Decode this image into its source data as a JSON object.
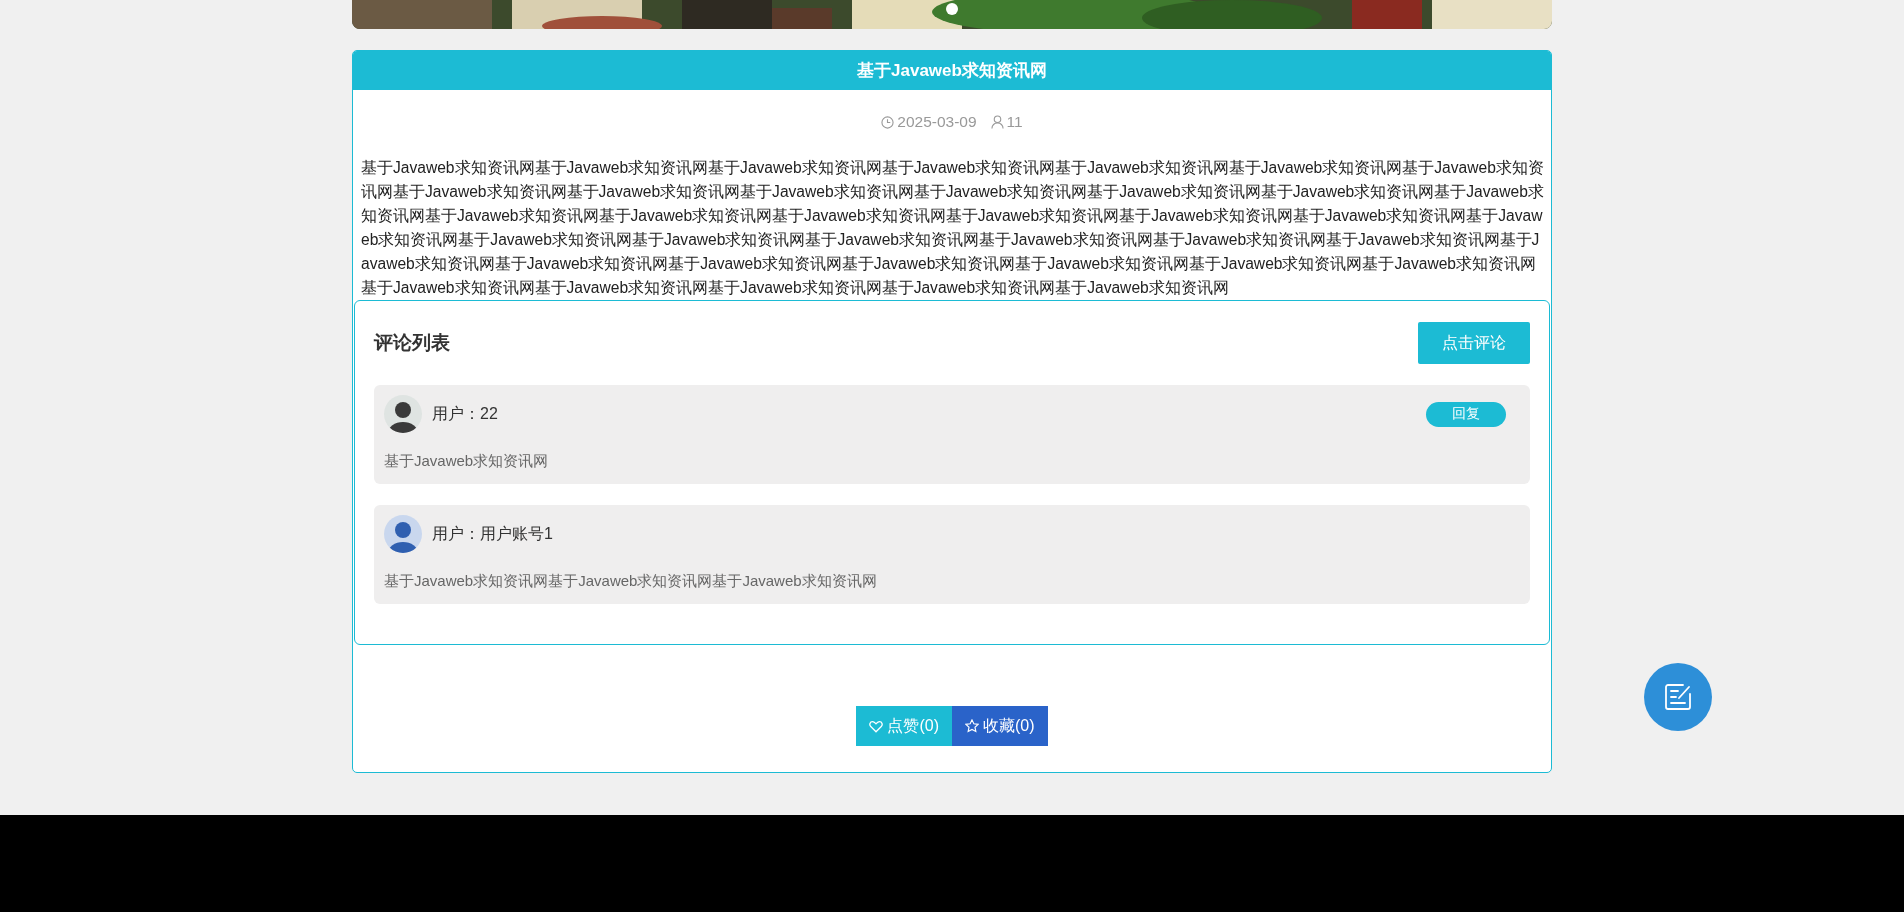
{
  "banner": {
    "kind": "picture",
    "dots": [
      {
        "selected": true
      }
    ]
  },
  "article": {
    "title": "基于Javaweb求知资讯网",
    "date": "2025-03-09",
    "views": "11",
    "body": "基于Javaweb求知资讯网基于Javaweb求知资讯网基于Javaweb求知资讯网基于Javaweb求知资讯网基于Javaweb求知资讯网基于Javaweb求知资讯网基于Javaweb求知资讯网基于Javaweb求知资讯网基于Javaweb求知资讯网基于Javaweb求知资讯网基于Javaweb求知资讯网基于Javaweb求知资讯网基于Javaweb求知资讯网基于Javaweb求知资讯网基于Javaweb求知资讯网基于Javaweb求知资讯网基于Javaweb求知资讯网基于Javaweb求知资讯网基于Javaweb求知资讯网基于Javaweb求知资讯网基于Javaweb求知资讯网基于Javaweb求知资讯网基于Javaweb求知资讯网基于Javaweb求知资讯网基于Javaweb求知资讯网基于Javaweb求知资讯网基于Javaweb求知资讯网基于Javaweb求知资讯网基于Javaweb求知资讯网基于Javaweb求知资讯网基于Javaweb求知资讯网基于Javaweb求知资讯网基于Javaweb求知资讯网基于Javaweb求知资讯网基于Javaweb求知资讯网基于Javaweb求知资讯网基于Javaweb求知资讯网基于Javaweb求知资讯网基于Javaweb求知资讯网"
  },
  "comments": {
    "title": "评论列表",
    "add_button": "点击评论",
    "items": [
      {
        "user_label": "用户：22",
        "text": "基于Javaweb求知资讯网",
        "reply_button": "回复"
      },
      {
        "user_label": "用户：用户账号1",
        "text": "基于Javaweb求知资讯网基于Javaweb求知资讯网基于Javaweb求知资讯网"
      }
    ]
  },
  "actions": [
    {
      "kind": "like",
      "label": "点赞(0)"
    },
    {
      "kind": "favorite",
      "label": "收藏(0)"
    }
  ],
  "fab": {
    "kind": "edit"
  }
}
